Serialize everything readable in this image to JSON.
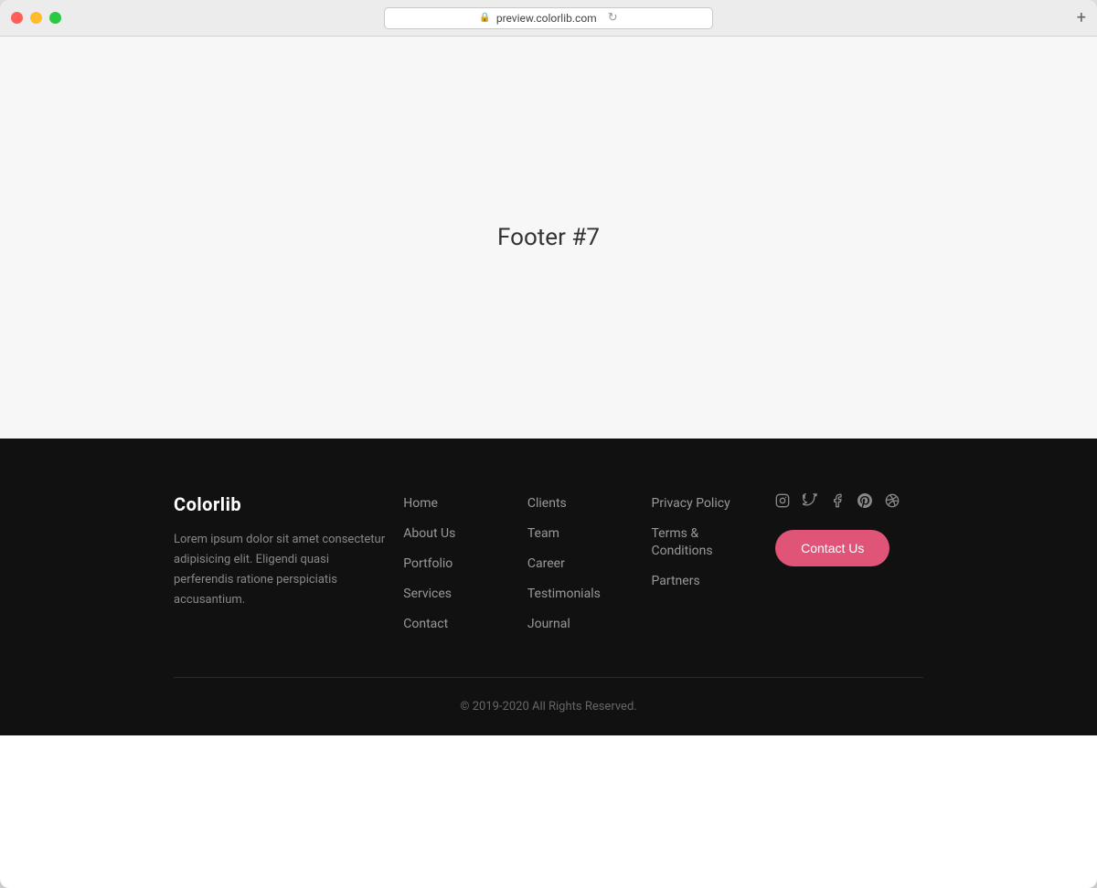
{
  "browser": {
    "url": "preview.colorlib.com",
    "new_tab_icon": "+"
  },
  "page": {
    "title": "Footer #7"
  },
  "footer": {
    "brand": "Colorlib",
    "description": "Lorem ipsum dolor sit amet consectetur adipisicing elit. Eligendi quasi perferendis ratione perspiciatis accusantium.",
    "nav_col1": {
      "items": [
        {
          "label": "Home",
          "href": "#"
        },
        {
          "label": "About Us",
          "href": "#"
        },
        {
          "label": "Portfolio",
          "href": "#"
        },
        {
          "label": "Services",
          "href": "#"
        },
        {
          "label": "Contact",
          "href": "#"
        }
      ]
    },
    "nav_col2": {
      "items": [
        {
          "label": "Clients",
          "href": "#"
        },
        {
          "label": "Team",
          "href": "#"
        },
        {
          "label": "Career",
          "href": "#"
        },
        {
          "label": "Testimonials",
          "href": "#"
        },
        {
          "label": "Journal",
          "href": "#"
        }
      ]
    },
    "nav_col3": {
      "items": [
        {
          "label": "Privacy Policy",
          "href": "#"
        },
        {
          "label": "Terms & Conditions",
          "href": "#"
        },
        {
          "label": "Partners",
          "href": "#"
        }
      ]
    },
    "social": {
      "icons": [
        {
          "name": "instagram-icon",
          "symbol": "𝕀",
          "unicode": "📷"
        },
        {
          "name": "twitter-icon",
          "symbol": "𝕋",
          "unicode": "🐦"
        },
        {
          "name": "facebook-icon",
          "symbol": "𝔽",
          "unicode": "𝑓"
        },
        {
          "name": "pinterest-icon",
          "symbol": "𝕻",
          "unicode": "𝑝"
        },
        {
          "name": "dribbble-icon",
          "symbol": "𝔻",
          "unicode": "🏀"
        }
      ],
      "contact_button": "Contact Us"
    },
    "copyright": "© 2019-2020 All Rights Reserved."
  }
}
